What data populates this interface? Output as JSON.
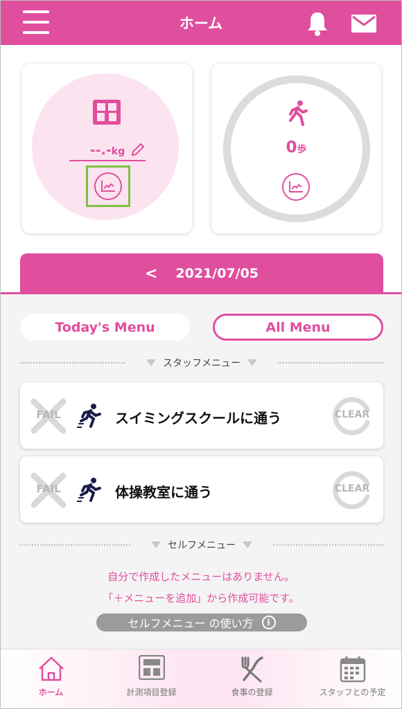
{
  "header": {
    "title": "ホーム"
  },
  "weight_card": {
    "value": "--.-",
    "unit": "kg"
  },
  "steps_card": {
    "value": "0",
    "unit": "歩"
  },
  "date_bar": {
    "prev_arrow": "<",
    "date": "2021/07/05"
  },
  "tabs": {
    "today": "Today's Menu",
    "all": "All Menu",
    "selected": "All Menu"
  },
  "staff_section": {
    "label": "スタッフメニュー"
  },
  "menu_items": [
    {
      "fail": "FAIL",
      "title": "スイミングスクールに通う",
      "clear": "CLEAR"
    },
    {
      "fail": "FAIL",
      "title": "体操教室に通う",
      "clear": "CLEAR"
    }
  ],
  "self_section": {
    "label": "セルフメニュー",
    "notice_line1": "自分で作成したメニューはありません。",
    "notice_line2": "「＋メニューを追加」から作成可能です。",
    "howto_label": "セルフメニュー の使い方",
    "info_glyph": "i"
  },
  "bottom_nav": [
    {
      "label": "ホーム",
      "icon": "home-icon",
      "active": true
    },
    {
      "label": "計測項目登録",
      "icon": "scale-icon",
      "active": false
    },
    {
      "label": "食事の登録",
      "icon": "utensils-icon",
      "active": false
    },
    {
      "label": "スタッフとの予定",
      "icon": "calendar-icon",
      "active": false
    }
  ],
  "colors": {
    "accent": "#e04e9e",
    "highlight": "#7cc142",
    "muted": "#b7b7b7"
  }
}
